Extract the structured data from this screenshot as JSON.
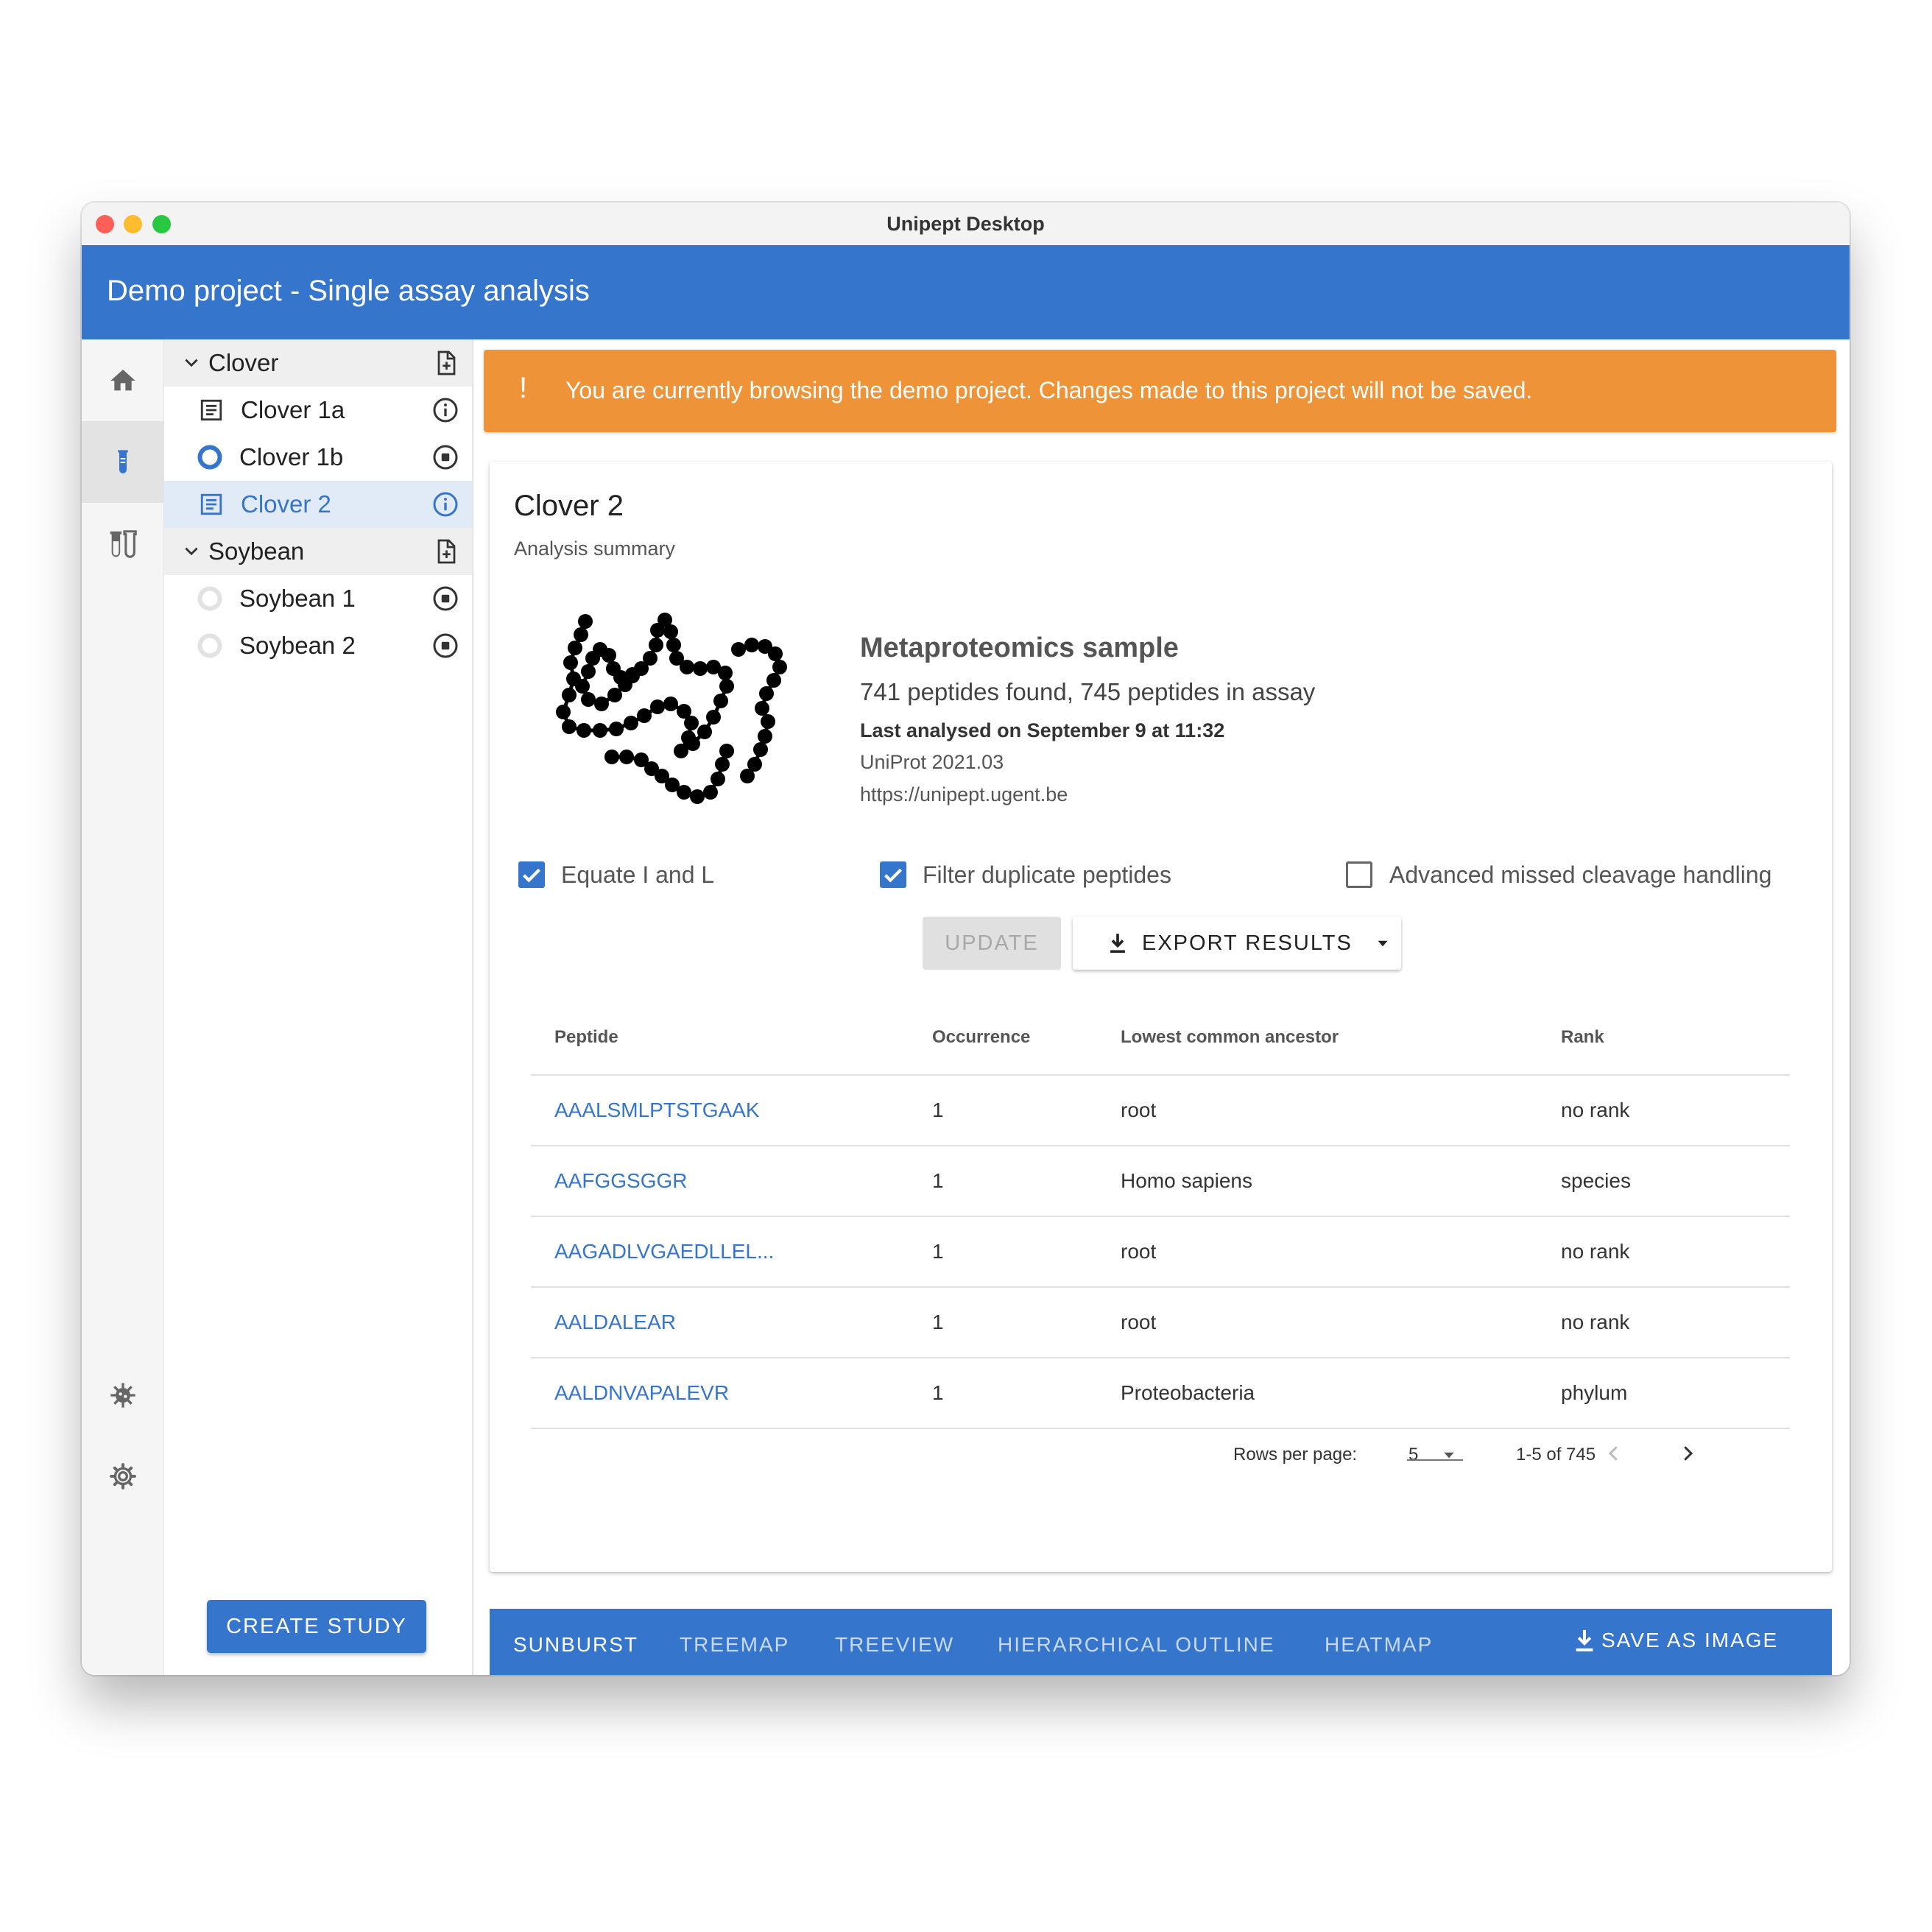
{
  "window": {
    "title": "Unipept Desktop"
  },
  "app": {
    "title": "Demo project - Single assay analysis"
  },
  "nav": {
    "icons": [
      "home-icon",
      "flask-icon",
      "test-tubes-icon",
      "virus-icon",
      "gear-icon"
    ]
  },
  "tree": {
    "groups": [
      {
        "label": "Clover",
        "items": [
          {
            "label": "Clover 1a",
            "status": "analysed"
          },
          {
            "label": "Clover 1b",
            "status": "processing"
          },
          {
            "label": "Clover 2",
            "status": "analysed",
            "selected": true
          }
        ]
      },
      {
        "label": "Soybean",
        "items": [
          {
            "label": "Soybean 1",
            "status": "pending"
          },
          {
            "label": "Soybean 2",
            "status": "pending"
          }
        ]
      }
    ],
    "create_study_label": "CREATE STUDY"
  },
  "banner": {
    "icon": "!",
    "message": "You are currently browsing the demo project. Changes made to this project will not be saved."
  },
  "summary": {
    "title": "Clover 2",
    "subtitle": "Analysis summary",
    "sample_title": "Metaproteomics sample",
    "peptides_text": "741 peptides found, 745 peptides in assay",
    "last_analysed": "Last analysed on September 9 at 11:32",
    "uniprot": "UniProt 2021.03",
    "url": "https://unipept.ugent.be"
  },
  "options": {
    "equate_il": {
      "label": "Equate I and L",
      "checked": true
    },
    "filter_duplicates": {
      "label": "Filter duplicate peptides",
      "checked": true
    },
    "missed_cleavage": {
      "label": "Advanced missed cleavage handling",
      "checked": false
    }
  },
  "actions": {
    "update_label": "UPDATE",
    "export_label": "EXPORT RESULTS"
  },
  "table": {
    "headers": {
      "peptide": "Peptide",
      "occurrence": "Occurrence",
      "lca": "Lowest common ancestor",
      "rank": "Rank"
    },
    "rows": [
      {
        "peptide": "AAALSMLPTSTGAAK",
        "occurrence": "1",
        "lca": "root",
        "rank": "no rank"
      },
      {
        "peptide": "AAFGGSGGR",
        "occurrence": "1",
        "lca": "Homo sapiens",
        "rank": "species"
      },
      {
        "peptide": "AAGADLVGAEDLLEL...",
        "occurrence": "1",
        "lca": "root",
        "rank": "no rank"
      },
      {
        "peptide": "AALDALEAR",
        "occurrence": "1",
        "lca": "root",
        "rank": "no rank"
      },
      {
        "peptide": "AALDNVAPALEVR",
        "occurrence": "1",
        "lca": "Proteobacteria",
        "rank": "phylum"
      }
    ],
    "pagination": {
      "rows_per_page_label": "Rows per page:",
      "rows_per_page": "5",
      "range": "1-5 of 745"
    }
  },
  "tabs": {
    "items": [
      "SUNBURST",
      "TREEMAP",
      "TREEVIEW",
      "HIERARCHICAL OUTLINE",
      "HEATMAP"
    ],
    "active": "SUNBURST",
    "save_label": "SAVE AS IMAGE"
  },
  "colors": {
    "primary": "#3675cc",
    "warning": "#ee9337",
    "selected_row": "#e1ebf8"
  }
}
